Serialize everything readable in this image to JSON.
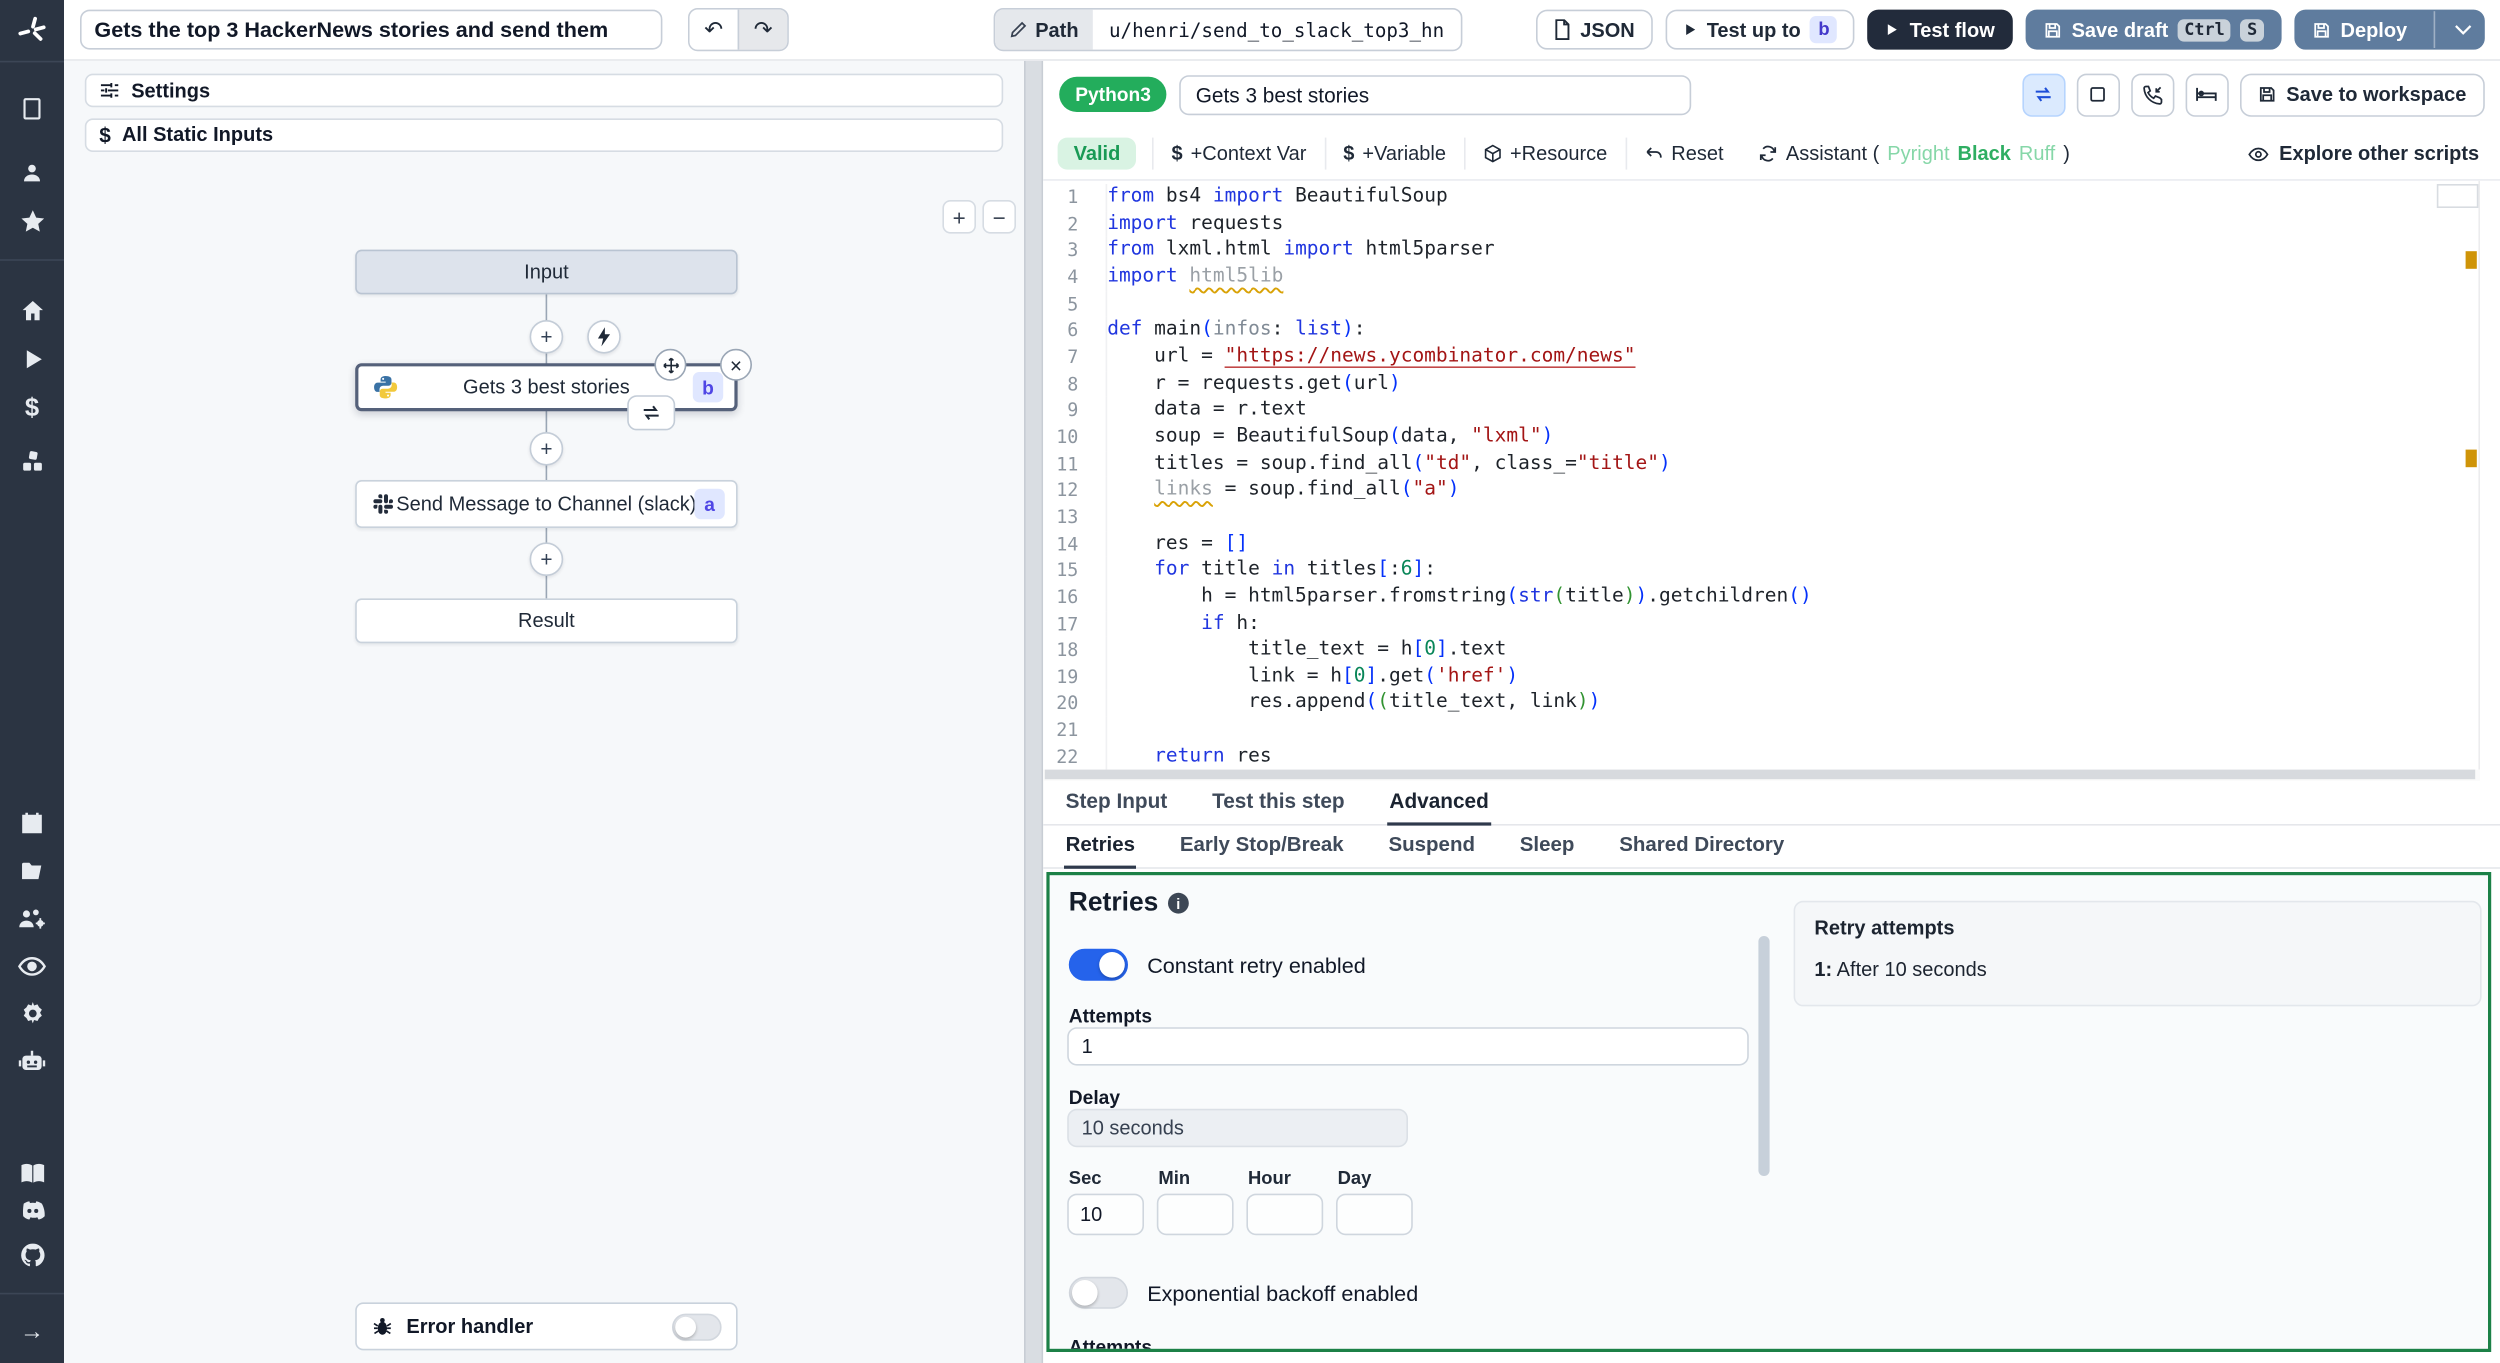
{
  "icons": {
    "undo": "↶",
    "redo": "↷",
    "plus": "+",
    "minus": "−",
    "close": "×",
    "dollar": "$",
    "arrow_right": "→"
  },
  "topbar": {
    "flow_title": "Gets the top 3 HackerNews stories and send them",
    "path_label": "Path",
    "path_value": "u/henri/send_to_slack_top3_hn",
    "json_label": "JSON",
    "test_up_to_label": "Test up to",
    "test_up_to_badge": "b",
    "test_flow_label": "Test flow",
    "save_draft_label": "Save draft",
    "save_draft_kbd": [
      "Ctrl",
      "S"
    ],
    "deploy_label": "Deploy"
  },
  "flow": {
    "settings_label": "Settings",
    "static_inputs_label": "All Static Inputs",
    "nodes": {
      "input": "Input",
      "step_b": {
        "label": "Gets 3 best stories",
        "badge": "b"
      },
      "step_a": {
        "label": "Send Message to Channel (slack)",
        "badge": "a"
      },
      "result": "Result"
    },
    "error_handler_label": "Error handler",
    "error_handler_enabled": false
  },
  "editor": {
    "lang_badge": "Python3",
    "step_name": "Gets 3 best stories",
    "save_to_workspace_label": "Save to workspace",
    "toolbar": {
      "valid": "Valid",
      "context_var": "+Context Var",
      "variable": "+Variable",
      "resource": "+Resource",
      "reset": "Reset",
      "assistant_prefix": "Assistant (",
      "assistant_items": [
        "Pyright",
        "Black",
        "Ruff"
      ],
      "assistant_suffix": ")",
      "explore": "Explore other scripts"
    },
    "code_lines": [
      {
        "n": 1,
        "tokens": [
          [
            "k",
            "from"
          ],
          [
            "d",
            " bs4 "
          ],
          [
            "k",
            "import"
          ],
          [
            "d",
            " BeautifulSoup"
          ]
        ]
      },
      {
        "n": 2,
        "tokens": [
          [
            "k",
            "import"
          ],
          [
            "d",
            " requests"
          ]
        ]
      },
      {
        "n": 3,
        "tokens": [
          [
            "k",
            "from"
          ],
          [
            "d",
            " lxml.html "
          ],
          [
            "k",
            "import"
          ],
          [
            "d",
            " html5parser"
          ]
        ]
      },
      {
        "n": 4,
        "tokens": [
          [
            "k",
            "import"
          ],
          [
            "d",
            " "
          ],
          [
            "gw",
            "html5lib"
          ]
        ]
      },
      {
        "n": 5,
        "tokens": []
      },
      {
        "n": 6,
        "tokens": [
          [
            "k",
            "def"
          ],
          [
            "d",
            " main"
          ],
          [
            "p1",
            "("
          ],
          [
            "pr",
            "infos"
          ],
          [
            "d",
            ": "
          ],
          [
            "k2",
            "list"
          ],
          [
            "p1",
            ")"
          ],
          [
            "d",
            ":"
          ]
        ]
      },
      {
        "n": 7,
        "tokens": [
          [
            "d",
            "    url = "
          ],
          [
            "su",
            "\"https://news.ycombinator.com/news\""
          ]
        ]
      },
      {
        "n": 8,
        "tokens": [
          [
            "d",
            "    r = requests.get"
          ],
          [
            "p1",
            "("
          ],
          [
            "d",
            "url"
          ],
          [
            "p1",
            ")"
          ]
        ]
      },
      {
        "n": 9,
        "tokens": [
          [
            "d",
            "    data = r.text"
          ]
        ]
      },
      {
        "n": 10,
        "tokens": [
          [
            "d",
            "    soup = BeautifulSoup"
          ],
          [
            "p1",
            "("
          ],
          [
            "d",
            "data, "
          ],
          [
            "s",
            "\"lxml\""
          ],
          [
            "p1",
            ")"
          ]
        ]
      },
      {
        "n": 11,
        "tokens": [
          [
            "d",
            "    titles = soup.find_all"
          ],
          [
            "p1",
            "("
          ],
          [
            "s",
            "\"td\""
          ],
          [
            "d",
            ", class_="
          ],
          [
            "s",
            "\"title\""
          ],
          [
            "p1",
            ")"
          ]
        ]
      },
      {
        "n": 12,
        "tokens": [
          [
            "d",
            "    "
          ],
          [
            "gw",
            "links"
          ],
          [
            "d",
            " = soup.find_all"
          ],
          [
            "p1",
            "("
          ],
          [
            "s",
            "\"a\""
          ],
          [
            "p1",
            ")"
          ]
        ]
      },
      {
        "n": 13,
        "tokens": []
      },
      {
        "n": 14,
        "tokens": [
          [
            "d",
            "    res = "
          ],
          [
            "p1",
            "[]"
          ]
        ]
      },
      {
        "n": 15,
        "tokens": [
          [
            "d",
            "    "
          ],
          [
            "k",
            "for"
          ],
          [
            "d",
            " title "
          ],
          [
            "k",
            "in"
          ],
          [
            "d",
            " titles"
          ],
          [
            "p1",
            "["
          ],
          [
            "d",
            ":"
          ],
          [
            "n",
            "6"
          ],
          [
            "p1",
            "]"
          ],
          [
            "d",
            ":"
          ]
        ]
      },
      {
        "n": 16,
        "tokens": [
          [
            "d",
            "        h = html5parser.fromstring"
          ],
          [
            "p1",
            "("
          ],
          [
            "k2",
            "str"
          ],
          [
            "p2",
            "("
          ],
          [
            "d",
            "title"
          ],
          [
            "p2",
            ")"
          ],
          [
            "p1",
            ")"
          ],
          [
            "d",
            ".getchildren"
          ],
          [
            "p1",
            "()"
          ]
        ]
      },
      {
        "n": 17,
        "tokens": [
          [
            "d",
            "        "
          ],
          [
            "k",
            "if"
          ],
          [
            "d",
            " h:"
          ]
        ]
      },
      {
        "n": 18,
        "tokens": [
          [
            "d",
            "            title_text = h"
          ],
          [
            "p1",
            "["
          ],
          [
            "n",
            "0"
          ],
          [
            "p1",
            "]"
          ],
          [
            "d",
            ".text"
          ]
        ]
      },
      {
        "n": 19,
        "tokens": [
          [
            "d",
            "            link = h"
          ],
          [
            "p1",
            "["
          ],
          [
            "n",
            "0"
          ],
          [
            "p1",
            "]"
          ],
          [
            "d",
            ".get"
          ],
          [
            "p1",
            "("
          ],
          [
            "s",
            "'href'"
          ],
          [
            "p1",
            ")"
          ]
        ]
      },
      {
        "n": 20,
        "tokens": [
          [
            "d",
            "            res.append"
          ],
          [
            "p1",
            "("
          ],
          [
            "p2",
            "("
          ],
          [
            "d",
            "title_text, link"
          ],
          [
            "p2",
            ")"
          ],
          [
            "p1",
            ")"
          ]
        ]
      },
      {
        "n": 21,
        "tokens": []
      },
      {
        "n": 22,
        "tokens": [
          [
            "d",
            "    "
          ],
          [
            "k",
            "return"
          ],
          [
            "d",
            " res"
          ]
        ]
      }
    ]
  },
  "tabs": {
    "main": [
      "Step Input",
      "Test this step",
      "Advanced"
    ],
    "active_main": "Advanced",
    "sub": [
      "Retries",
      "Early Stop/Break",
      "Suspend",
      "Sleep",
      "Shared Directory"
    ],
    "active_sub": "Retries"
  },
  "retries": {
    "title": "Retries",
    "constant_toggle_label": "Constant retry enabled",
    "constant_enabled": true,
    "attempts_label": "Attempts",
    "attempts_value": "1",
    "delay_label": "Delay",
    "delay_value": "10 seconds",
    "time_fields": [
      {
        "label": "Sec",
        "value": "10"
      },
      {
        "label": "Min",
        "value": ""
      },
      {
        "label": "Hour",
        "value": ""
      },
      {
        "label": "Day",
        "value": ""
      }
    ],
    "exponential_toggle_label": "Exponential backoff enabled",
    "exponential_enabled": false,
    "attempts2_label": "Attempts",
    "summary": {
      "title": "Retry attempts",
      "items": [
        {
          "n": "1:",
          "text": "After 10 seconds"
        }
      ]
    }
  }
}
